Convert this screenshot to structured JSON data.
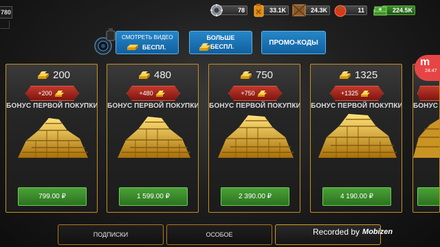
{
  "topbar": {
    "level": "780",
    "resources": [
      {
        "name": "silver",
        "value": "78",
        "icon": "gear-shield-icon"
      },
      {
        "name": "fuel",
        "value": "33.1K",
        "icon": "fuel-canister-icon"
      },
      {
        "name": "crates",
        "value": "24.3K",
        "icon": "wooden-crate-icon"
      },
      {
        "name": "tomatoes",
        "value": "11",
        "icon": "tomato-icon"
      },
      {
        "name": "cash",
        "value": "224.5K",
        "icon": "cash-stack-icon"
      }
    ]
  },
  "actions": {
    "watch_video_line1": "СМОТРЕТЬ ВИДЕО",
    "watch_video_line2": "БЕСПЛ.",
    "more_line1": "БОЛЬШЕ",
    "more_line2": "БЕСПЛ.",
    "promo": "ПРОМО-КОДЫ"
  },
  "cards": [
    {
      "amount": "200",
      "bonus": "+200",
      "bonus_label": "БОНУС ПЕРВОЙ ПОКУПКИ",
      "price": "799.00 ₽"
    },
    {
      "amount": "480",
      "bonus": "+480",
      "bonus_label": "БОНУС ПЕРВОЙ ПОКУПКИ",
      "price": "1 599.00 ₽"
    },
    {
      "amount": "750",
      "bonus": "+750",
      "bonus_label": "БОНУС ПЕРВОЙ ПОКУПКИ",
      "price": "2 390.00 ₽"
    },
    {
      "amount": "1325",
      "bonus": "+1325",
      "bonus_label": "БОНУС ПЕРВОЙ ПОКУПКИ",
      "price": "4 190.00 ₽"
    },
    {
      "amount": "",
      "bonus": "",
      "bonus_label": "БОНУС ПЕРВОЙ ПОКУПКИ",
      "price": ""
    }
  ],
  "tabs": {
    "subscriptions": "ПОДПИСКИ",
    "special": "ОСОБОЕ"
  },
  "overlay": {
    "recorded_by": "Recorded by",
    "brand": "Mobizen",
    "bubble_letter": "m",
    "bubble_time": "24:47"
  },
  "colors": {
    "gold_border": "#c7911e",
    "price_green": "#3f9630",
    "action_blue": "#1d77b8",
    "bonus_red": "#b0311f"
  }
}
